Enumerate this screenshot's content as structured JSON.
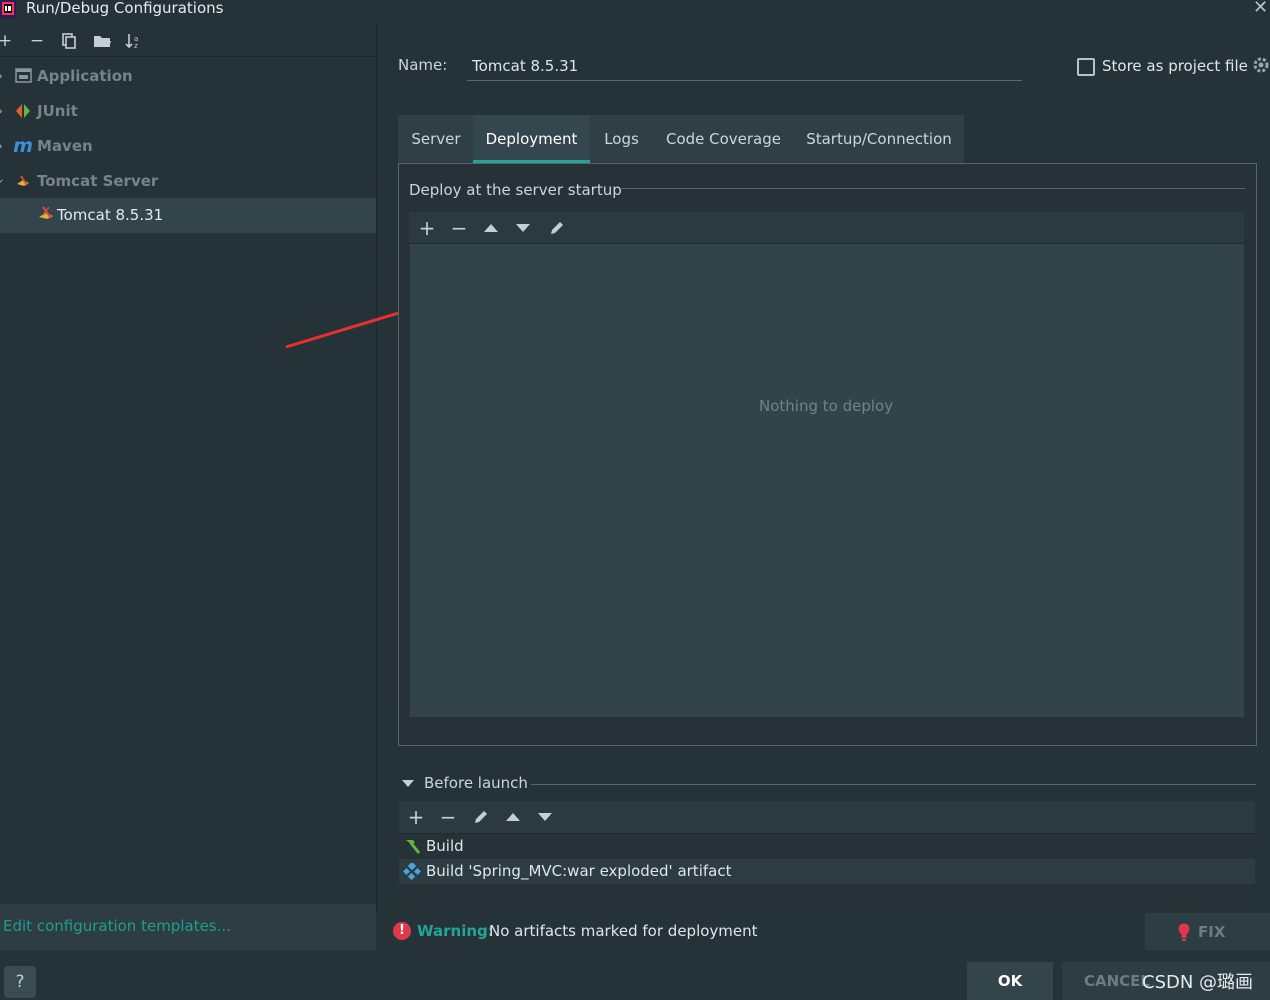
{
  "window": {
    "title": "Run/Debug Configurations"
  },
  "left_toolbar": {
    "icons": [
      "add-icon",
      "remove-icon",
      "copy-icon",
      "folder-icon",
      "sort-icon"
    ]
  },
  "tree": {
    "items": [
      {
        "label": "Application",
        "icon": "application-icon"
      },
      {
        "label": "JUnit",
        "icon": "junit-icon"
      },
      {
        "label": "Maven",
        "icon": "maven-icon"
      },
      {
        "label": "Tomcat Server",
        "icon": "tomcat-icon"
      }
    ],
    "selected": {
      "label": "Tomcat 8.5.31",
      "icon": "tomcat-icon"
    }
  },
  "edit_templates": "Edit configuration templates...",
  "name_field": {
    "label": "Name:",
    "value": "Tomcat 8.5.31"
  },
  "store_as_project": {
    "label": "Store as project file",
    "checked": false
  },
  "tabs": [
    {
      "label": "Server",
      "active": false
    },
    {
      "label": "Deployment",
      "active": true
    },
    {
      "label": "Logs",
      "active": false
    },
    {
      "label": "Code Coverage",
      "active": false
    },
    {
      "label": "Startup/Connection",
      "active": false
    }
  ],
  "deploy": {
    "title": "Deploy at the server startup",
    "empty_text": "Nothing to deploy"
  },
  "before_launch": {
    "title": "Before launch",
    "items": [
      {
        "label": "Build",
        "icon": "hammer-icon"
      },
      {
        "label": "Build 'Spring_MVC:war exploded' artifact",
        "icon": "artifact-icon"
      }
    ]
  },
  "status": {
    "warning_label": "Warning:",
    "warning_text": "No artifacts marked for deployment",
    "fix_label": "FIX"
  },
  "buttons": {
    "help": "?",
    "ok": "OK",
    "cancel": "CANCEL"
  },
  "watermark": "CSDN @璐画",
  "colors": {
    "accent": "#22a596",
    "warning": "#e0394a",
    "annotation_arrow": "#e8302f"
  }
}
